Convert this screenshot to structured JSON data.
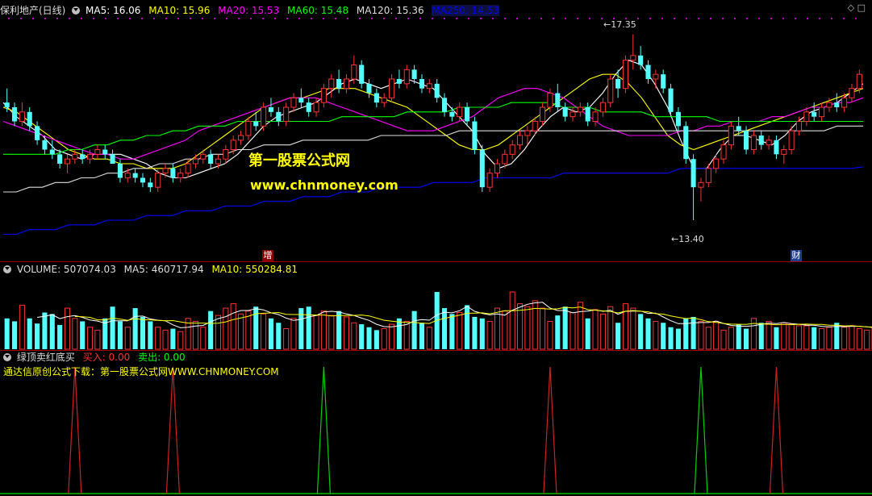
{
  "main_panel": {
    "title": "保利地产(日线)",
    "indicators": [
      {
        "label": "MA5: 16.06",
        "color": "#ffffff"
      },
      {
        "label": "MA10: 15.96",
        "color": "#ffff00"
      },
      {
        "label": "MA20: 15.53",
        "color": "#ff00ff"
      },
      {
        "label": "MA60: 15.48",
        "color": "#00ff00"
      },
      {
        "label": "MA120: 15.36",
        "color": "#dddddd"
      },
      {
        "label": "MA250: 14.53",
        "color": "#0000ff"
      }
    ],
    "watermark_cn": "第一股票公式网",
    "watermark_url": "www.chnmoney.com",
    "high_label": "17.35",
    "low_label": "13.40",
    "marker_left": "增",
    "marker_right": "财",
    "top_icons": "◇ □"
  },
  "volume_panel": {
    "title": "VOLUME: 507074.03",
    "ma5": "MA5: 460717.94",
    "ma10": "MA10: 550284.81"
  },
  "signal_panel": {
    "title": "绿顶卖红底买",
    "buy": "买入: 0.00",
    "sell": "卖出: 0.00",
    "note": "通达信原创公式下载：第一股票公式网WWW.CHNMONEY.COM"
  },
  "chart_data": {
    "type": "candlestick",
    "price_ylim": [
      12.8,
      17.6
    ],
    "candles": [
      [
        15.9,
        16.2,
        15.7,
        15.8
      ],
      [
        15.8,
        15.9,
        15.4,
        15.5
      ],
      [
        15.5,
        15.9,
        15.4,
        15.7
      ],
      [
        15.7,
        15.8,
        15.3,
        15.4
      ],
      [
        15.4,
        15.5,
        15.0,
        15.1
      ],
      [
        15.1,
        15.2,
        14.8,
        14.9
      ],
      [
        14.9,
        15.1,
        14.7,
        14.8
      ],
      [
        14.8,
        14.9,
        14.5,
        14.6
      ],
      [
        14.6,
        14.8,
        14.4,
        14.7
      ],
      [
        14.7,
        14.9,
        14.6,
        14.8
      ],
      [
        14.8,
        14.9,
        14.6,
        14.7
      ],
      [
        14.7,
        14.9,
        14.6,
        14.8
      ],
      [
        14.8,
        15.0,
        14.7,
        14.9
      ],
      [
        14.9,
        15.0,
        14.7,
        14.8
      ],
      [
        14.8,
        14.9,
        14.6,
        14.6
      ],
      [
        14.6,
        14.7,
        14.2,
        14.3
      ],
      [
        14.3,
        14.5,
        14.2,
        14.4
      ],
      [
        14.4,
        14.5,
        14.2,
        14.3
      ],
      [
        14.3,
        14.4,
        14.1,
        14.2
      ],
      [
        14.2,
        14.3,
        14.0,
        14.1
      ],
      [
        14.1,
        14.5,
        14.0,
        14.4
      ],
      [
        14.4,
        14.6,
        14.3,
        14.5
      ],
      [
        14.5,
        14.6,
        14.2,
        14.3
      ],
      [
        14.3,
        14.5,
        14.2,
        14.4
      ],
      [
        14.4,
        14.7,
        14.3,
        14.6
      ],
      [
        14.6,
        14.8,
        14.5,
        14.7
      ],
      [
        14.7,
        14.9,
        14.6,
        14.8
      ],
      [
        14.8,
        14.9,
        14.5,
        14.6
      ],
      [
        14.6,
        14.8,
        14.5,
        14.7
      ],
      [
        14.7,
        15.0,
        14.6,
        14.9
      ],
      [
        14.9,
        15.2,
        14.8,
        15.1
      ],
      [
        15.1,
        15.3,
        15.0,
        15.2
      ],
      [
        15.2,
        15.6,
        15.1,
        15.5
      ],
      [
        15.5,
        15.7,
        15.3,
        15.4
      ],
      [
        15.4,
        15.9,
        15.3,
        15.8
      ],
      [
        15.8,
        16.0,
        15.6,
        15.7
      ],
      [
        15.7,
        15.8,
        15.4,
        15.5
      ],
      [
        15.5,
        15.9,
        15.4,
        15.8
      ],
      [
        15.8,
        16.1,
        15.7,
        16.0
      ],
      [
        16.0,
        16.2,
        15.8,
        15.9
      ],
      [
        15.9,
        16.0,
        15.6,
        15.7
      ],
      [
        15.7,
        16.0,
        15.6,
        15.9
      ],
      [
        15.9,
        16.3,
        15.8,
        16.2
      ],
      [
        16.2,
        16.5,
        16.0,
        16.4
      ],
      [
        16.4,
        16.6,
        16.1,
        16.2
      ],
      [
        16.2,
        16.5,
        16.1,
        16.4
      ],
      [
        16.4,
        16.9,
        16.3,
        16.7
      ],
      [
        16.7,
        16.8,
        16.2,
        16.3
      ],
      [
        16.3,
        16.4,
        16.0,
        16.1
      ],
      [
        16.1,
        16.2,
        15.8,
        15.9
      ],
      [
        15.9,
        16.1,
        15.8,
        16.0
      ],
      [
        16.0,
        16.5,
        15.9,
        16.4
      ],
      [
        16.4,
        16.6,
        16.2,
        16.3
      ],
      [
        16.3,
        16.7,
        16.2,
        16.6
      ],
      [
        16.6,
        16.7,
        16.3,
        16.4
      ],
      [
        16.4,
        16.5,
        16.1,
        16.2
      ],
      [
        16.2,
        16.4,
        16.1,
        16.3
      ],
      [
        16.3,
        16.4,
        15.9,
        16.0
      ],
      [
        16.0,
        16.1,
        15.6,
        15.7
      ],
      [
        15.7,
        15.8,
        15.5,
        15.6
      ],
      [
        15.6,
        15.9,
        15.5,
        15.8
      ],
      [
        15.8,
        15.9,
        15.4,
        15.5
      ],
      [
        15.5,
        15.6,
        14.8,
        14.9
      ],
      [
        14.9,
        15.0,
        14.0,
        14.1
      ],
      [
        14.1,
        14.5,
        14.0,
        14.4
      ],
      [
        14.4,
        14.7,
        14.3,
        14.6
      ],
      [
        14.6,
        14.9,
        14.5,
        14.8
      ],
      [
        14.8,
        15.1,
        14.7,
        15.0
      ],
      [
        15.0,
        15.3,
        14.9,
        15.2
      ],
      [
        15.2,
        15.4,
        15.0,
        15.3
      ],
      [
        15.3,
        15.6,
        15.2,
        15.5
      ],
      [
        15.5,
        15.9,
        15.4,
        15.8
      ],
      [
        15.8,
        16.2,
        15.7,
        16.1
      ],
      [
        16.1,
        16.3,
        15.7,
        15.8
      ],
      [
        15.8,
        15.9,
        15.5,
        15.6
      ],
      [
        15.6,
        15.8,
        15.5,
        15.7
      ],
      [
        15.7,
        15.9,
        15.6,
        15.8
      ],
      [
        15.8,
        15.9,
        15.4,
        15.5
      ],
      [
        15.5,
        15.8,
        15.4,
        15.7
      ],
      [
        15.7,
        16.0,
        15.6,
        15.9
      ],
      [
        15.9,
        16.5,
        15.8,
        16.4
      ],
      [
        16.4,
        16.6,
        16.0,
        16.2
      ],
      [
        16.2,
        16.9,
        16.1,
        16.8
      ],
      [
        16.8,
        17.35,
        16.6,
        16.9
      ],
      [
        16.9,
        17.1,
        16.6,
        16.7
      ],
      [
        16.7,
        16.8,
        16.3,
        16.4
      ],
      [
        16.4,
        16.6,
        16.2,
        16.5
      ],
      [
        16.5,
        16.6,
        16.1,
        16.2
      ],
      [
        16.2,
        16.3,
        15.6,
        15.7
      ],
      [
        15.7,
        15.8,
        15.3,
        15.4
      ],
      [
        15.4,
        15.5,
        14.6,
        14.7
      ],
      [
        14.7,
        14.8,
        13.4,
        14.1
      ],
      [
        14.1,
        14.3,
        13.8,
        14.2
      ],
      [
        14.2,
        14.6,
        14.1,
        14.5
      ],
      [
        14.5,
        14.8,
        14.4,
        14.7
      ],
      [
        14.7,
        15.1,
        14.6,
        15.0
      ],
      [
        15.0,
        15.5,
        14.9,
        15.4
      ],
      [
        15.4,
        15.6,
        15.2,
        15.3
      ],
      [
        15.3,
        15.4,
        14.8,
        14.9
      ],
      [
        14.9,
        15.3,
        14.8,
        15.2
      ],
      [
        15.2,
        15.3,
        14.9,
        15.0
      ],
      [
        15.0,
        15.2,
        14.9,
        15.1
      ],
      [
        15.1,
        15.2,
        14.7,
        14.8
      ],
      [
        14.8,
        15.0,
        14.6,
        14.9
      ],
      [
        14.9,
        15.4,
        14.8,
        15.3
      ],
      [
        15.3,
        15.6,
        15.2,
        15.5
      ],
      [
        15.5,
        15.8,
        15.4,
        15.7
      ],
      [
        15.7,
        15.9,
        15.5,
        15.6
      ],
      [
        15.6,
        15.9,
        15.5,
        15.8
      ],
      [
        15.8,
        16.0,
        15.7,
        15.9
      ],
      [
        15.9,
        16.1,
        15.7,
        15.8
      ],
      [
        15.8,
        16.1,
        15.7,
        16.0
      ],
      [
        16.0,
        16.3,
        15.9,
        16.2
      ],
      [
        16.2,
        16.6,
        16.1,
        16.5
      ]
    ],
    "ma_series": [
      {
        "name": "MA5",
        "color": "#ffffff",
        "values": [
          15.9,
          15.6,
          15.4,
          15.2,
          14.9,
          14.8,
          14.7,
          14.8,
          14.8,
          14.8,
          14.7,
          14.6,
          14.4,
          14.3,
          14.3,
          14.4,
          14.5,
          14.6,
          14.8,
          15.1,
          15.4,
          15.6,
          15.7,
          15.8,
          15.9,
          16.1,
          16.3,
          16.4,
          16.3,
          16.2,
          16.3,
          16.4,
          16.3,
          16.2,
          15.9,
          15.6,
          15.3,
          14.8,
          14.5,
          14.6,
          14.9,
          15.3,
          15.6,
          15.8,
          15.7,
          15.8,
          16.1,
          16.5,
          16.8,
          16.7,
          16.3,
          15.8,
          15.1,
          14.5,
          14.5,
          14.9,
          15.2,
          15.2,
          15.1,
          15.0,
          15.2,
          15.5,
          15.7,
          15.8,
          15.9,
          16.1,
          16.3
        ]
      },
      {
        "name": "MA10",
        "color": "#ffff00",
        "values": [
          15.8,
          15.7,
          15.5,
          15.3,
          15.1,
          14.9,
          14.8,
          14.7,
          14.7,
          14.6,
          14.6,
          14.5,
          14.5,
          14.5,
          14.6,
          14.8,
          15.0,
          15.2,
          15.4,
          15.6,
          15.8,
          15.9,
          16.0,
          16.0,
          16.1,
          16.2,
          16.2,
          16.2,
          16.1,
          16.0,
          15.9,
          15.8,
          15.6,
          15.4,
          15.2,
          15.0,
          14.9,
          14.9,
          15.0,
          15.2,
          15.4,
          15.6,
          15.8,
          16.0,
          16.2,
          16.4,
          16.5,
          16.5,
          16.3,
          16.0,
          15.6,
          15.2,
          15.0,
          14.9,
          15.0,
          15.1,
          15.2,
          15.3,
          15.4,
          15.5,
          15.6,
          15.7,
          15.8,
          15.9,
          16.0,
          16.1,
          16.2
        ]
      },
      {
        "name": "MA20",
        "color": "#ff00ff",
        "values": [
          15.5,
          15.4,
          15.3,
          15.2,
          15.1,
          15.0,
          14.9,
          14.8,
          14.8,
          14.7,
          14.7,
          14.8,
          14.9,
          15.0,
          15.1,
          15.3,
          15.4,
          15.5,
          15.6,
          15.7,
          15.8,
          15.9,
          16.0,
          16.0,
          16.0,
          15.9,
          15.8,
          15.7,
          15.6,
          15.5,
          15.4,
          15.3,
          15.3,
          15.3,
          15.4,
          15.5,
          15.6,
          15.8,
          16.0,
          16.1,
          16.2,
          16.2,
          16.1,
          16.0,
          15.8,
          15.6,
          15.4,
          15.3,
          15.2,
          15.2,
          15.2,
          15.2,
          15.3,
          15.3,
          15.4,
          15.4,
          15.5,
          15.5,
          15.5,
          15.6,
          15.6,
          15.7,
          15.8,
          15.8,
          15.9,
          15.9,
          16.0
        ]
      },
      {
        "name": "MA60",
        "color": "#00ff00",
        "values": [
          14.8,
          14.8,
          14.8,
          14.8,
          14.8,
          14.9,
          14.9,
          15.0,
          15.0,
          15.1,
          15.1,
          15.2,
          15.2,
          15.3,
          15.3,
          15.4,
          15.4,
          15.4,
          15.5,
          15.5,
          15.5,
          15.5,
          15.5,
          15.5,
          15.5,
          15.5,
          15.6,
          15.6,
          15.6,
          15.6,
          15.6,
          15.7,
          15.7,
          15.7,
          15.7,
          15.8,
          15.8,
          15.8,
          15.8,
          15.9,
          15.9,
          15.9,
          15.9,
          15.8,
          15.8,
          15.8,
          15.7,
          15.7,
          15.7,
          15.7,
          15.6,
          15.6,
          15.6,
          15.6,
          15.6,
          15.5,
          15.5,
          15.5,
          15.5,
          15.5,
          15.5,
          15.5,
          15.5,
          15.5,
          15.5,
          15.5,
          15.5
        ]
      },
      {
        "name": "MA120",
        "color": "#dddddd",
        "values": [
          14.0,
          14.0,
          14.1,
          14.1,
          14.2,
          14.2,
          14.3,
          14.3,
          14.4,
          14.4,
          14.5,
          14.5,
          14.6,
          14.6,
          14.7,
          14.7,
          14.8,
          14.8,
          14.9,
          14.9,
          15.0,
          15.0,
          15.0,
          15.1,
          15.1,
          15.1,
          15.1,
          15.1,
          15.1,
          15.2,
          15.2,
          15.2,
          15.2,
          15.2,
          15.2,
          15.3,
          15.3,
          15.3,
          15.3,
          15.3,
          15.3,
          15.3,
          15.3,
          15.3,
          15.3,
          15.3,
          15.3,
          15.3,
          15.3,
          15.3,
          15.3,
          15.3,
          15.3,
          15.3,
          15.3,
          15.3,
          15.3,
          15.3,
          15.3,
          15.3,
          15.3,
          15.3,
          15.3,
          15.3,
          15.4,
          15.4,
          15.4
        ]
      },
      {
        "name": "MA250",
        "color": "#0000ff",
        "values": [
          13.1,
          13.1,
          13.2,
          13.2,
          13.2,
          13.3,
          13.3,
          13.3,
          13.4,
          13.4,
          13.4,
          13.5,
          13.5,
          13.5,
          13.6,
          13.6,
          13.6,
          13.7,
          13.7,
          13.7,
          13.8,
          13.8,
          13.8,
          13.9,
          13.9,
          13.9,
          14.0,
          14.0,
          14.0,
          14.1,
          14.1,
          14.1,
          14.1,
          14.2,
          14.2,
          14.2,
          14.2,
          14.3,
          14.3,
          14.3,
          14.3,
          14.3,
          14.3,
          14.4,
          14.4,
          14.4,
          14.4,
          14.4,
          14.4,
          14.4,
          14.4,
          14.4,
          14.5,
          14.5,
          14.5,
          14.5,
          14.5,
          14.5,
          14.5,
          14.5,
          14.5,
          14.5,
          14.5,
          14.5,
          14.5,
          14.5,
          14.53
        ]
      }
    ],
    "volume_ylim": [
      0,
      1000000
    ],
    "volume": [
      420000,
      380000,
      600000,
      420000,
      350000,
      500000,
      480000,
      330000,
      560000,
      420000,
      380000,
      300000,
      260000,
      420000,
      580000,
      380000,
      300000,
      560000,
      440000,
      380000,
      300000,
      260000,
      280000,
      240000,
      420000,
      380000,
      300000,
      520000,
      460000,
      560000,
      620000,
      480000,
      520000,
      580000,
      480000,
      420000,
      360000,
      280000,
      420000,
      560000,
      580000,
      460000,
      520000,
      460000,
      520000,
      440000,
      360000,
      340000,
      300000,
      260000,
      280000,
      340000,
      420000,
      380000,
      520000,
      360000,
      300000,
      780000,
      560000,
      480000,
      500000,
      600000,
      440000,
      420000,
      380000,
      560000,
      520000,
      780000,
      620000,
      580000,
      660000,
      560000,
      380000,
      460000,
      580000,
      500000,
      640000,
      420000,
      540000,
      480000,
      580000,
      360000,
      620000,
      560000,
      480000,
      420000,
      380000,
      360000,
      300000,
      280000,
      420000,
      440000,
      380000,
      300000,
      380000,
      260000,
      300000,
      340000,
      280000,
      420000,
      360000,
      380000,
      300000,
      360000,
      340000,
      320000,
      320000,
      300000,
      280000,
      300000,
      360000,
      300000,
      320000,
      280000,
      260000,
      300000
    ],
    "signals": [
      {
        "index": 9,
        "type": "buy"
      },
      {
        "index": 22,
        "type": "buy"
      },
      {
        "index": 42,
        "type": "sell"
      },
      {
        "index": 72,
        "type": "buy"
      },
      {
        "index": 92,
        "type": "sell"
      },
      {
        "index": 102,
        "type": "buy"
      }
    ]
  }
}
